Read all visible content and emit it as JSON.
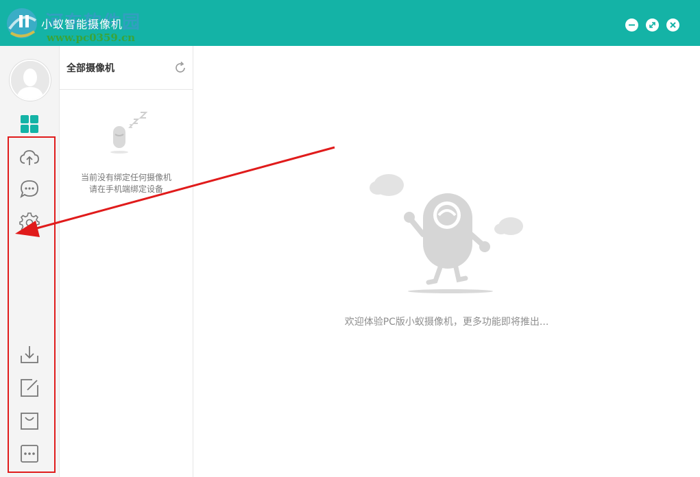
{
  "window": {
    "title": "小蚁智能摄像机",
    "minimize_icon": "minimize-icon",
    "maximize_icon": "maximize-icon",
    "close_icon": "close-icon",
    "accent_color": "#14b3a6"
  },
  "watermark": {
    "text": "河东软件园",
    "url": "www.pc0359.cn"
  },
  "sidebar": {
    "avatar_icon": "user-avatar-icon",
    "top_items": [
      {
        "icon": "grid-icon",
        "active": true
      },
      {
        "icon": "cloud-upload-icon"
      },
      {
        "icon": "chat-bubble-icon"
      },
      {
        "icon": "settings-gear-icon"
      }
    ],
    "bottom_items": [
      {
        "icon": "download-icon"
      },
      {
        "icon": "edit-icon"
      },
      {
        "icon": "shopping-bag-icon"
      },
      {
        "icon": "more-icon"
      }
    ]
  },
  "camera_panel": {
    "title": "全部摄像机",
    "refresh_icon": "refresh-icon",
    "empty_line1": "当前没有绑定任何摄像机",
    "empty_line2": "请在手机端绑定设备"
  },
  "main": {
    "welcome_text": "欢迎体验PC版小蚁摄像机，更多功能即将推出..."
  },
  "annotation": {
    "color": "#e01b1b"
  }
}
